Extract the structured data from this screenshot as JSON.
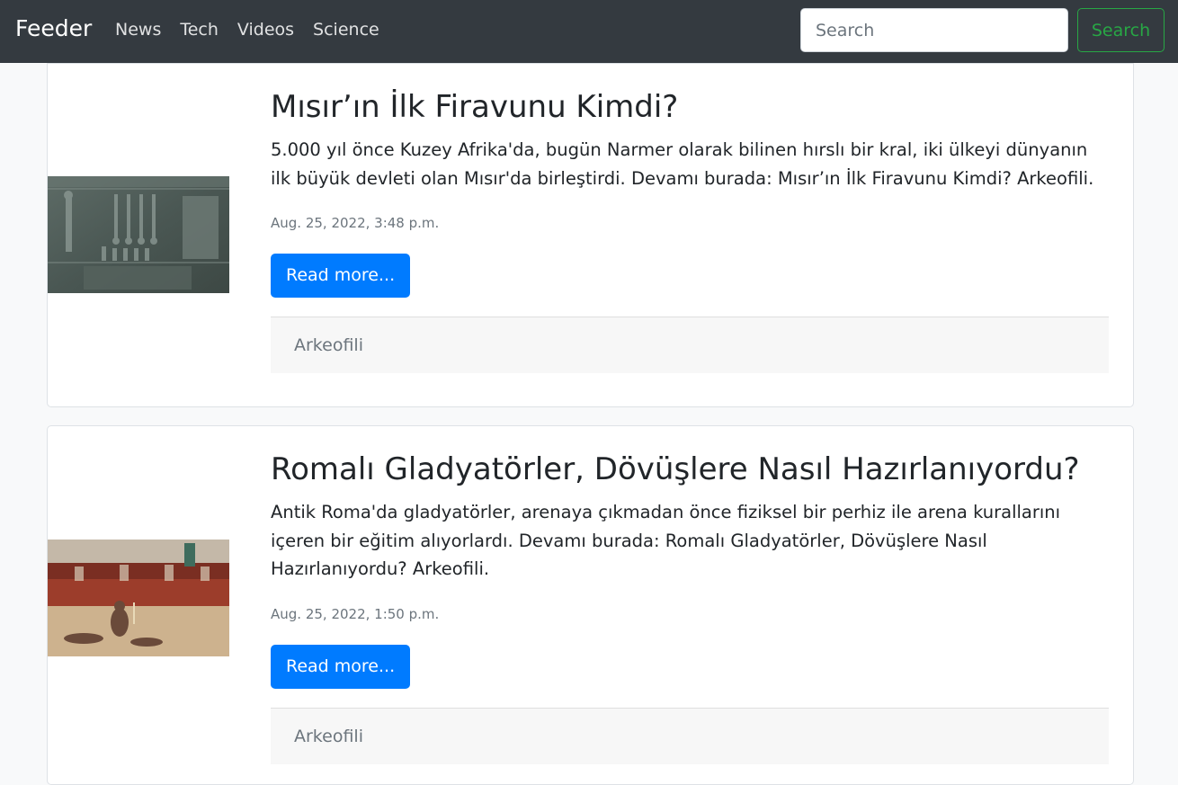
{
  "navbar": {
    "brand": "Feeder",
    "links": [
      "News",
      "Tech",
      "Videos",
      "Science"
    ],
    "search_placeholder": "Search",
    "search_button": "Search"
  },
  "articles": [
    {
      "title": "Mısır’ın İlk Firavunu Kimdi?",
      "description": "5.000 yıl önce Kuzey Afrika'da, bugün Narmer olarak bilinen hırslı bir kral, iki ülkeyi dünyanın ilk büyük devleti olan Mısır'da birleştirdi. Devamı burada: Mısır’ın İlk Firavunu Kimdi? Arkeofili.",
      "date": "Aug. 25, 2022, 3:48 p.m.",
      "button": "Read more...",
      "source": "Arkeofili"
    },
    {
      "title": "Romalı Gladyatörler, Dövüşlere Nasıl Hazırlanıyordu?",
      "description": "Antik Roma'da gladyatörler, arenaya çıkmadan önce fiziksel bir perhiz ile arena kurallarını içeren bir eğitim alıyorlardı. Devamı burada: Romalı Gladyatörler, Dövüşlere Nasıl Hazırlanıyordu? Arkeofili.",
      "date": "Aug. 25, 2022, 1:50 p.m.",
      "button": "Read more...",
      "source": "Arkeofili"
    }
  ],
  "colors": {
    "navbar_bg": "#343a40",
    "primary": "#007bff",
    "success": "#28a745",
    "muted": "#6c757d"
  }
}
